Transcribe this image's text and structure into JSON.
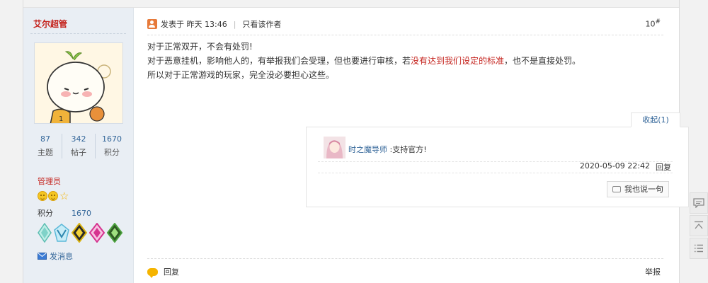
{
  "sidebar": {
    "username": "艾尔超管",
    "stats": [
      {
        "value": "87",
        "label": "主题"
      },
      {
        "value": "342",
        "label": "帖子"
      },
      {
        "value": "1670",
        "label": "积分"
      }
    ],
    "group": "管理员",
    "credits_label": "积分",
    "credits_value": "1670",
    "medal_colors": [
      "#7fd2c8",
      "#5bb8d8",
      "#d9b20f",
      "#d6338f",
      "#4aa03c"
    ],
    "pm_label": "发消息"
  },
  "post": {
    "posted_label": "发表于",
    "posted_time": "昨天 13:46",
    "only_author": "只看该作者",
    "floor_number": "10",
    "floor_mark": "#",
    "content": {
      "line1": "对于正常双开，不会有处罚!",
      "line2_pre": "对于恶意挂机，影响他人的，有举报我们会受理，但也要进行审核，若",
      "line2_red": "没有达到我们设定的标准",
      "line2_post": "，也不是直接处罚。",
      "line3": "所以对于正常游戏的玩家，完全没必要担心这些。"
    },
    "accent_color": "#c4221c"
  },
  "comments": {
    "collapse_label": "收起(1)",
    "items": [
      {
        "user": "时之魔导师",
        "message": ":支持官方!",
        "time": "2020-05-09 22:42",
        "reply_label": "回复"
      }
    ],
    "say_button": "我也说一句"
  },
  "footer": {
    "reply_label": "回复",
    "report_label": "举报"
  }
}
